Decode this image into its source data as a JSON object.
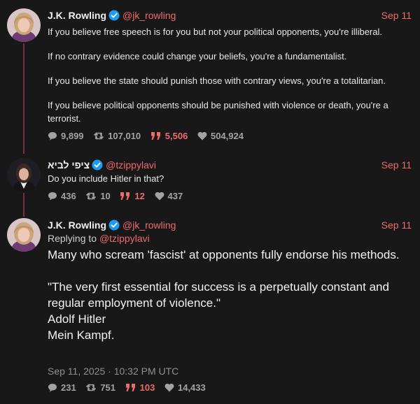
{
  "colors": {
    "background": "#181818",
    "accent": "#f06a6a",
    "verified": "#1d9bf0",
    "thread_line": "#7a2f35"
  },
  "tweets": [
    {
      "name": "J.K. Rowling",
      "handle": "@jk_rowling",
      "date": "Sep 11",
      "verified": true,
      "avatar_icon": "jk-rowling-avatar",
      "paragraphs": [
        "If you believe free speech is for you but not your political opponents, you're illiberal.",
        "If no contrary evidence could change your beliefs, you're a fundamentalist.",
        "If you believe the state should punish those with contrary views, you're a totalitarian.",
        "If you believe political opponents should be punished with violence or death, you're a terrorist."
      ],
      "stats": {
        "replies": "9,899",
        "retweets": "107,010",
        "quotes": "5,506",
        "likes": "504,924"
      }
    },
    {
      "name": "ציפי לביא",
      "handle": "@tzippylavi",
      "date": "Sep 11",
      "verified": true,
      "avatar_icon": "tzippy-lavi-avatar",
      "text": "Do you include Hitler in that?",
      "stats": {
        "replies": "436",
        "retweets": "10",
        "quotes": "12",
        "likes": "437"
      }
    },
    {
      "name": "J.K. Rowling",
      "handle": "@jk_rowling",
      "date": "Sep 11",
      "verified": true,
      "avatar_icon": "jk-rowling-avatar",
      "replying_prefix": "Replying to",
      "replying_to": "@tzippylavi",
      "lines": [
        "Many who scream 'fascist' at opponents fully endorse his methods.",
        "\"The very first essential for success is a perpetually constant and regular employment of violence.\"",
        "Adolf Hitler",
        "Mein Kampf."
      ],
      "timestamp": "Sep 11, 2025 · 10:32 PM UTC",
      "stats": {
        "replies": "231",
        "retweets": "751",
        "quotes": "103",
        "likes": "14,433"
      }
    }
  ]
}
